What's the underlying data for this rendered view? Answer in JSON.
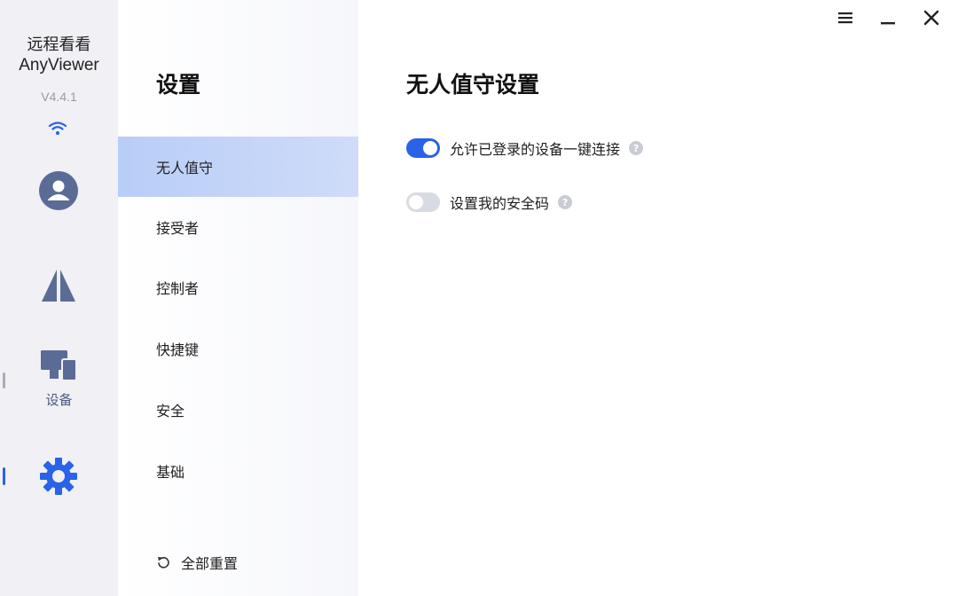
{
  "app": {
    "name_cn": "远程看看",
    "name_en": "AnyViewer",
    "version": "V4.4.1"
  },
  "rail": {
    "items": [
      {
        "icon": "user-avatar-icon"
      },
      {
        "icon": "transfer-icon"
      },
      {
        "icon": "devices-icon",
        "label": "设备"
      },
      {
        "icon": "gear-icon",
        "active": true
      }
    ],
    "accent": "#2a62e8",
    "icon_color": "#5a6c96"
  },
  "settings_nav": {
    "title": "设置",
    "items": [
      {
        "label": "无人值守",
        "active": true
      },
      {
        "label": "接受者"
      },
      {
        "label": "控制者"
      },
      {
        "label": "快捷键"
      },
      {
        "label": "安全"
      },
      {
        "label": "基础"
      }
    ],
    "reset_label": "全部重置"
  },
  "main": {
    "title": "无人值守设置",
    "options": [
      {
        "label": "允许已登录的设备一键连接",
        "enabled": true,
        "help": "?"
      },
      {
        "label": "设置我的安全码",
        "enabled": false,
        "help": "?"
      }
    ]
  },
  "window_controls": [
    "menu-icon",
    "minimize-icon",
    "close-icon"
  ]
}
